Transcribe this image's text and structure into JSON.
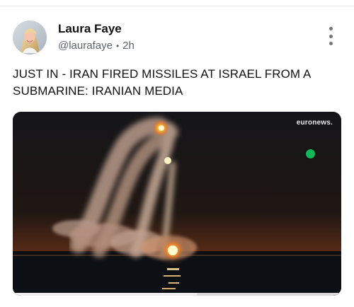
{
  "post": {
    "author_name": "Laura Faye",
    "handle": "@laurafaye",
    "separator": "•",
    "time_ago": "2h",
    "text": "JUST IN - IRAN FIRED MISSILES AT ISRAEL FROM A SUBMARINE: IRANIAN MEDIA"
  },
  "media": {
    "watermark": "euronews.",
    "progress": 0.56
  },
  "icons": {
    "avatar": "user-avatar",
    "more": "vertical-more-icon",
    "video_status": "green-status-dot"
  },
  "colors": {
    "link_gray": "#5b6269",
    "status_green": "#12b65a",
    "video_background": "#101014"
  }
}
